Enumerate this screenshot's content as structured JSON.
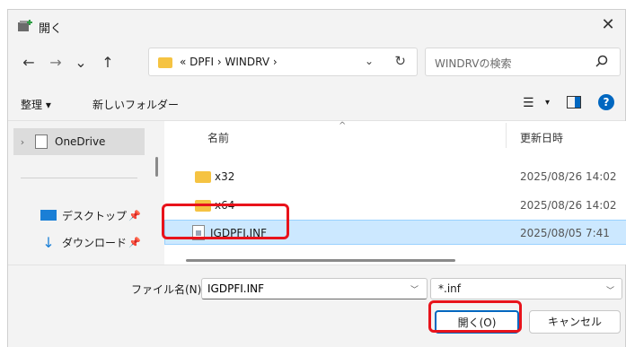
{
  "window": {
    "title": "開く",
    "close_symbol": "✕"
  },
  "nav": {
    "back": "←",
    "forward": "→",
    "recent": "⌄",
    "up": "↑",
    "address": {
      "path_prefix": "«",
      "path": "DPFI › WINDRV ›",
      "dropdown": "⌄",
      "refresh": "↻"
    },
    "search": {
      "placeholder": "WINDRVの検索"
    }
  },
  "commandbar": {
    "organize": "整理 ▾",
    "new_folder": "新しいフォルダー",
    "view_icon": "☰",
    "view_caret": "▾"
  },
  "navpane": {
    "items": [
      {
        "label": "OneDrive",
        "arrow": "›"
      },
      {
        "label": "デスクトップ",
        "pin": "📌"
      },
      {
        "label": "ダウンロード",
        "pin": "📌",
        "icon": "↓"
      }
    ]
  },
  "filelist": {
    "columns": {
      "name": "名前",
      "modified": "更新日時",
      "sort": "^"
    },
    "rows": [
      {
        "name": "x32",
        "modified": "2025/08/26 14:02",
        "type": "folder"
      },
      {
        "name": "x64",
        "modified": "2025/08/26 14:02",
        "type": "folder"
      },
      {
        "name": "IGDPFI.INF",
        "modified": "2025/08/05 7:41",
        "type": "inf",
        "selected": true
      }
    ]
  },
  "bottom": {
    "filename_label": "ファイル名(N):",
    "filename_value": "IGDPFI.INF",
    "filetype_value": "*.inf",
    "open_button": "開く(O)",
    "cancel_button": "キャンセル"
  },
  "colors": {
    "accent": "#0067c0",
    "highlight": "#e8131b",
    "selection": "#cce8ff",
    "folder": "#f5c342"
  }
}
